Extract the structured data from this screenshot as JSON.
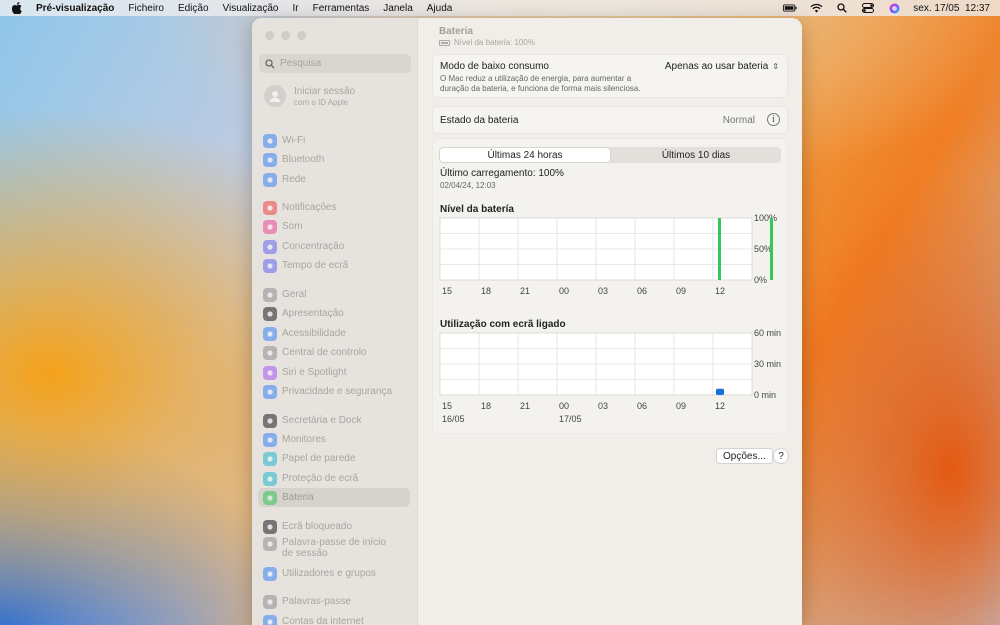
{
  "menubar": {
    "app_name": "Pré-visualização",
    "items": [
      "Ficheiro",
      "Edição",
      "Visualização",
      "Ir",
      "Ferramentas",
      "Janela",
      "Ajuda"
    ],
    "clock": "sex. 17/05  12:37"
  },
  "sidebar": {
    "search_placeholder": "Pesquisa",
    "account": {
      "title": "Iniciar sessão",
      "subtitle": "com o ID Apple"
    },
    "items": [
      {
        "label": "Wi-Fi",
        "icon": "wifi-icon",
        "color": "#3b82f6"
      },
      {
        "label": "Bluetooth",
        "icon": "bluetooth-icon",
        "color": "#3b82f6"
      },
      {
        "label": "Rede",
        "icon": "globe-icon",
        "color": "#3b82f6"
      },
      {
        "label": "Notificações",
        "icon": "bell-icon",
        "color": "#ef4444"
      },
      {
        "label": "Som",
        "icon": "speaker-icon",
        "color": "#ec4899"
      },
      {
        "label": "Concentração",
        "icon": "moon-icon",
        "color": "#6366f1"
      },
      {
        "label": "Tempo de ecrã",
        "icon": "hourglass-icon",
        "color": "#6366f1"
      },
      {
        "label": "Geral",
        "icon": "gear-icon",
        "color": "#8e8e93"
      },
      {
        "label": "Apresentação",
        "icon": "appearance-icon",
        "color": "#1c1c1e"
      },
      {
        "label": "Acessibilidade",
        "icon": "accessibility-icon",
        "color": "#3b82f6"
      },
      {
        "label": "Central de controlo",
        "icon": "control-center-icon",
        "color": "#8e8e93"
      },
      {
        "label": "Siri e Spotlight",
        "icon": "siri-icon",
        "color": "#a855f7"
      },
      {
        "label": "Privacidade e segurança",
        "icon": "hand-icon",
        "color": "#3b82f6"
      },
      {
        "label": "Secretária e Dock",
        "icon": "dock-icon",
        "color": "#1c1c1e"
      },
      {
        "label": "Monitores",
        "icon": "sun-icon",
        "color": "#3b82f6"
      },
      {
        "label": "Papel de parede",
        "icon": "wallpaper-icon",
        "color": "#22b8cf"
      },
      {
        "label": "Proteção de ecrã",
        "icon": "screensaver-icon",
        "color": "#22b8cf"
      },
      {
        "label": "Bateria",
        "icon": "battery-icon",
        "color": "#34c759"
      },
      {
        "label": "Ecrã bloqueado",
        "icon": "lock-screen-icon",
        "color": "#1c1c1e"
      },
      {
        "label": "Palavra-passe de início de sessão",
        "icon": "lock-icon",
        "color": "#8e8e93"
      },
      {
        "label": "Utilizadores e grupos",
        "icon": "users-icon",
        "color": "#3b82f6"
      },
      {
        "label": "Palavras-passe",
        "icon": "key-icon",
        "color": "#8e8e93"
      },
      {
        "label": "Contas da internet",
        "icon": "at-icon",
        "color": "#3b82f6"
      }
    ]
  },
  "main": {
    "title": "Bateria",
    "subtitle": "Nível da bateria: 100%",
    "low_power": {
      "label": "Modo de baixo consumo",
      "description": "O Mac reduz a utilização de energia, para aumentar a duração da bateria, e funciona de forma mais silenciosa.",
      "value": "Apenas ao usar bateria"
    },
    "battery_state": {
      "label": "Estado da bateria",
      "value": "Normal"
    },
    "tabs": [
      "Últimas 24 horas",
      "Últimos 10 dias"
    ],
    "selected_tab": 0,
    "last_charge": {
      "label": "Último carregamento: 100%",
      "date": "02/04/24, 12:03"
    },
    "options_label": "Opções...",
    "help_label": "?"
  },
  "chart_data": [
    {
      "type": "bar",
      "title": "Nível da batería",
      "x": [
        "15",
        "18",
        "21",
        "00",
        "03",
        "06",
        "09",
        "12"
      ],
      "y_ticks": [
        "100%",
        "50%",
        "0%"
      ],
      "ylim": [
        0,
        100
      ],
      "bars": [
        {
          "x": "12",
          "offset_hours": 0.0,
          "value": 100
        },
        {
          "x": "12",
          "offset_hours": 0.5,
          "value": 100
        }
      ],
      "bar_color": "#34c759"
    },
    {
      "type": "bar",
      "title": "Utilização com ecrã ligado",
      "x": [
        "15",
        "18",
        "21",
        "00",
        "03",
        "06",
        "09",
        "12"
      ],
      "date_labels": [
        {
          "at": "15",
          "text": "16/05"
        },
        {
          "at": "00",
          "text": "17/05"
        }
      ],
      "y_ticks": [
        "60 min",
        "30 min",
        "0 min"
      ],
      "ylim": [
        0,
        60
      ],
      "bars": [
        {
          "x": "12",
          "offset_hours": 0.0,
          "value": 6
        }
      ],
      "bar_color": "#1a6fd8"
    }
  ]
}
